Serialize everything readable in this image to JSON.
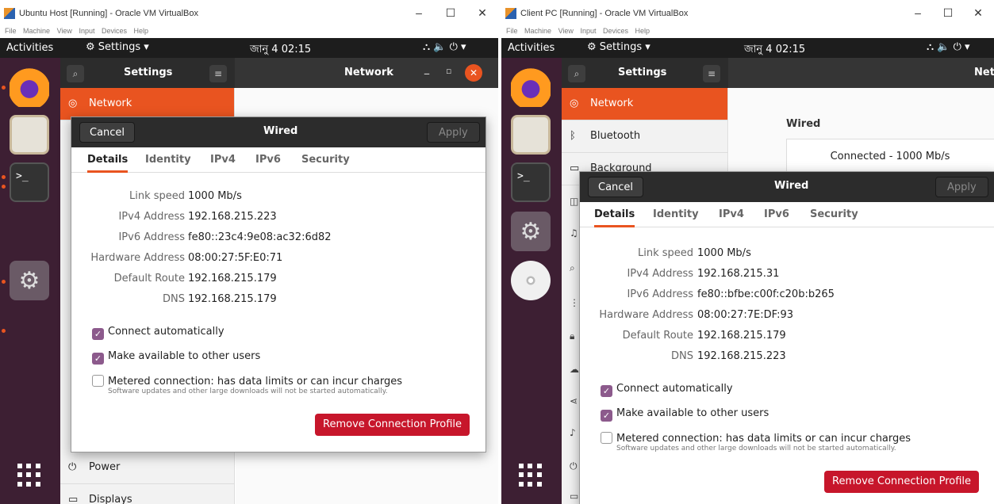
{
  "left": {
    "window_title": "Ubuntu Host [Running] - Oracle VM VirtualBox",
    "vb_menu": [
      "File",
      "Machine",
      "View",
      "Input",
      "Devices",
      "Help"
    ],
    "activities": "Activities",
    "app_menu": "Settings",
    "clock": "জানু 4 02:15",
    "settings_title": "Settings",
    "panel_title": "Network",
    "sidebar": {
      "network": "Network",
      "power": "Power",
      "displays": "Displays"
    },
    "dialog": {
      "cancel": "Cancel",
      "title": "Wired",
      "apply": "Apply",
      "tabs": [
        "Details",
        "Identity",
        "IPv4",
        "IPv6",
        "Security"
      ],
      "details": [
        {
          "label": "Link speed",
          "value": "1000 Mb/s"
        },
        {
          "label": "IPv4 Address",
          "value": "192.168.215.223"
        },
        {
          "label": "IPv6 Address",
          "value": "fe80::23c4:9e08:ac32:6d82"
        },
        {
          "label": "Hardware Address",
          "value": "08:00:27:5F:E0:71"
        },
        {
          "label": "Default Route",
          "value": "192.168.215.179"
        },
        {
          "label": "DNS",
          "value": "192.168.215.179"
        }
      ],
      "connect_auto": "Connect automatically",
      "make_available": "Make available to other users",
      "metered": "Metered connection: has data limits or can incur charges",
      "metered_sub": "Software updates and other large downloads will not be started automatically.",
      "remove": "Remove Connection Profile"
    }
  },
  "right": {
    "window_title": "Client PC [Running] - Oracle VM VirtualBox",
    "vb_menu": [
      "File",
      "Machine",
      "View",
      "Input",
      "Devices",
      "Help"
    ],
    "activities": "Activities",
    "app_menu": "Settings",
    "clock": "জানু 4 02:15",
    "settings_title": "Settings",
    "panel_title": "Net",
    "sidebar": {
      "network": "Network",
      "bluetooth": "Bluetooth",
      "background": "Background"
    },
    "bg_wired": "Wired",
    "bg_connected": "Connected - 1000 Mb/s",
    "dialog": {
      "cancel": "Cancel",
      "title": "Wired",
      "apply": "Apply",
      "tabs": [
        "Details",
        "Identity",
        "IPv4",
        "IPv6",
        "Security"
      ],
      "details": [
        {
          "label": "Link speed",
          "value": "1000 Mb/s"
        },
        {
          "label": "IPv4 Address",
          "value": "192.168.215.31"
        },
        {
          "label": "IPv6 Address",
          "value": "fe80::bfbe:c00f:c20b:b265"
        },
        {
          "label": "Hardware Address",
          "value": "08:00:27:7E:DF:93"
        },
        {
          "label": "Default Route",
          "value": "192.168.215.179"
        },
        {
          "label": "DNS",
          "value": "192.168.215.223"
        }
      ],
      "connect_auto": "Connect automatically",
      "make_available": "Make available to other users",
      "metered": "Metered connection: has data limits or can incur charges",
      "metered_sub": "Software updates and other large downloads will not be started automatically.",
      "remove": "Remove Connection Profile"
    }
  },
  "colors": {
    "accent": "#e95420",
    "dock": "#3d1f33",
    "headerbar": "#2c2c2c",
    "remove": "#c7162b",
    "checkbox": "#8c5a8c"
  }
}
